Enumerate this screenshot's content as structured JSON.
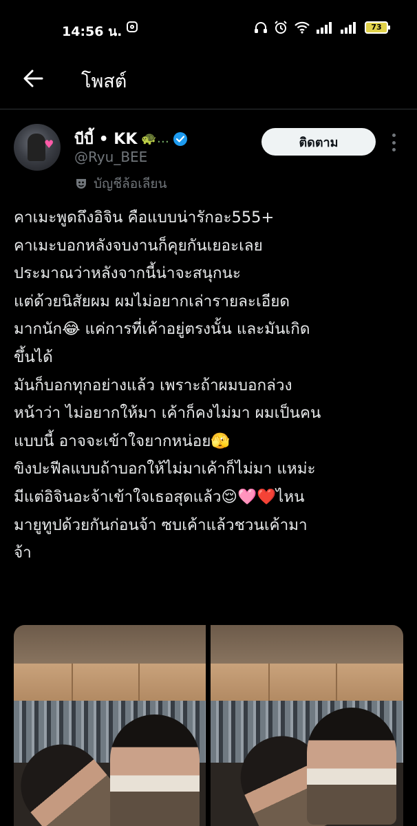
{
  "status_bar": {
    "time": "14:56 น.",
    "battery": "73"
  },
  "header": {
    "title": "โพสต์"
  },
  "tweet": {
    "display_name": "บีบี้ • KK",
    "name_emoji": "🐢…",
    "handle": "@Ryu_BEE",
    "parody_label": "บัญชีล้อเลียน",
    "follow_label": "ติดตาม",
    "lines": [
      "คาเมะพูดถึงอิจิน คือแบบน่ารักอะ555+",
      "คาเมะบอกหลังจบงานก็คุยกันเยอะเลย",
      "ประมาณว่าหลังจากนี้น่าจะสนุกนะ",
      "แต่ด้วยนิสัยผม ผมไม่อยากเล่ารายละเอียด",
      "มากนัก😂 แค่การที่เค้าอยู่ตรงนั้น และมันเกิด",
      "ขึ้นได้",
      "มันก็บอกทุกอย่างแล้ว เพราะถ้าผมบอกล่วง",
      "หน้าว่า ไม่อยากให้มา เค้าก็คงไม่มา ผมเป็นคน",
      "แบบนี้ อาจจะเข้าใจยากหน่อย🫣",
      "ขิงปะฟีลแบบถ้าบอกให้ไม่มาเค้าก็ไม่มา แหม่ะ",
      "มีแต่อิจินอะจ้าเข้าใจเธอสุดแล้ว😌🩷❤️ไหน",
      "มายูทูปด้วยกันก่อนจ้า ซบเค้าแล้วชวนเค้ามา",
      "จ้า"
    ]
  },
  "colors": {
    "background": "#000000",
    "text": "#e7e9ea",
    "secondary": "#71767b",
    "verified": "#1d9bf0",
    "follow_bg": "#eff3f4"
  }
}
